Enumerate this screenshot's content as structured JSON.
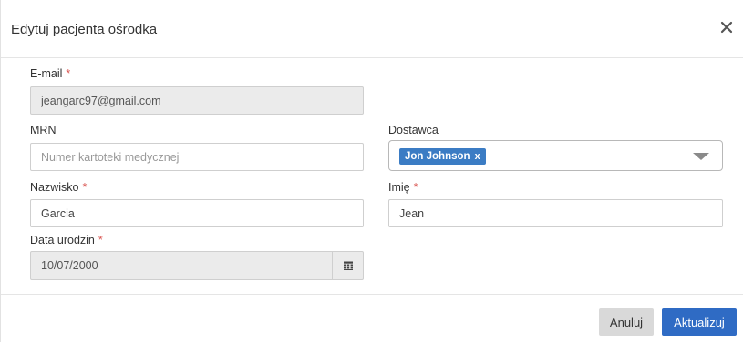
{
  "modal": {
    "title": "Edytuj pacjenta ośrodka",
    "close_icon": "close-icon"
  },
  "form": {
    "email": {
      "label": "E-mail",
      "required": "*",
      "value": "jeangarc97@gmail.com"
    },
    "mrn": {
      "label": "MRN",
      "placeholder": "Numer kartoteki medycznej",
      "value": ""
    },
    "provider": {
      "label": "Dostawca",
      "selected": "Jon Johnson",
      "remove": "x",
      "caret_icon": "chevron-down-icon"
    },
    "last_name": {
      "label": "Nazwisko",
      "required": "*",
      "value": "Garcia"
    },
    "first_name": {
      "label": "Imię",
      "required": "*",
      "value": "Jean"
    },
    "dob": {
      "label": "Data urodzin",
      "required": "*",
      "value": "10/07/2000",
      "icon": "calendar-icon"
    }
  },
  "footer": {
    "cancel_label": "Anuluj",
    "submit_label": "Aktualizuj"
  },
  "colors": {
    "primary": "#2f6bc4",
    "tag": "#3b7cc4",
    "required": "#d9534f",
    "disabled_bg": "#ebebeb"
  }
}
